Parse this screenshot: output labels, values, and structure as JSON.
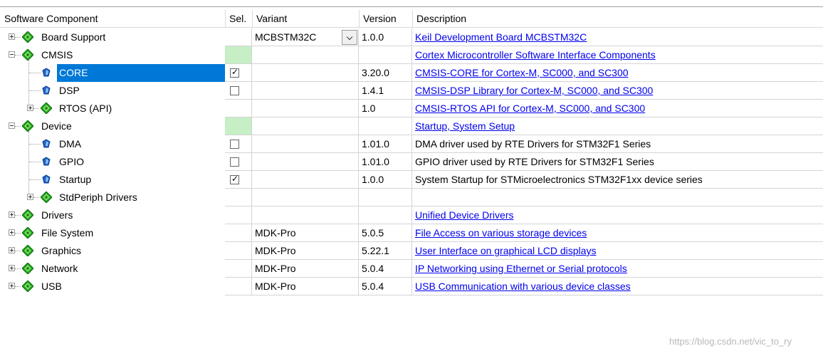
{
  "header": {
    "component": "Software Component",
    "sel": "Sel.",
    "variant": "Variant",
    "version": "Version",
    "description": "Description"
  },
  "rows": [
    {
      "label": "Board Support",
      "level": 0,
      "icon": "green-diamond-icon",
      "expander": "plus",
      "variant": "MCBSTM32C",
      "has_dropdown": true,
      "version": "1.0.0",
      "description": "Keil Development Board MCBSTM32C",
      "link": true,
      "checkbox": null,
      "green_sel": false
    },
    {
      "label": "CMSIS",
      "level": 0,
      "icon": "green-diamond-icon",
      "expander": "minus",
      "variant": "",
      "version": "",
      "description": "Cortex Microcontroller Software Interface Components",
      "link": true,
      "checkbox": null,
      "green_sel": true
    },
    {
      "label": "CORE",
      "level": 1,
      "icon": "blue-component-icon",
      "expander": "",
      "variant": "",
      "version": "3.20.0",
      "description": "CMSIS-CORE for Cortex-M, SC000, and SC300",
      "link": true,
      "checkbox": true,
      "green_sel": false,
      "selected": true
    },
    {
      "label": "DSP",
      "level": 1,
      "icon": "blue-component-icon",
      "expander": "",
      "variant": "",
      "version": "1.4.1",
      "description": "CMSIS-DSP Library for Cortex-M, SC000, and SC300",
      "link": true,
      "checkbox": false,
      "green_sel": false
    },
    {
      "label": "RTOS (API)",
      "level": 1,
      "icon": "green-diamond-icon",
      "expander": "plus",
      "variant": "",
      "version": "1.0",
      "description": "CMSIS-RTOS API for Cortex-M, SC000, and SC300",
      "link": true,
      "checkbox": null,
      "green_sel": false
    },
    {
      "label": "Device",
      "level": 0,
      "icon": "green-diamond-icon",
      "expander": "minus",
      "variant": "",
      "version": "",
      "description": "Startup, System Setup",
      "link": true,
      "checkbox": null,
      "green_sel": true
    },
    {
      "label": "DMA",
      "level": 1,
      "icon": "blue-component-icon",
      "expander": "",
      "variant": "",
      "version": "1.01.0",
      "description": "DMA driver used by RTE Drivers for STM32F1 Series",
      "link": false,
      "checkbox": false,
      "green_sel": false
    },
    {
      "label": "GPIO",
      "level": 1,
      "icon": "blue-component-icon",
      "expander": "",
      "variant": "",
      "version": "1.01.0",
      "description": "GPIO driver used by RTE Drivers for STM32F1 Series",
      "link": false,
      "checkbox": false,
      "green_sel": false
    },
    {
      "label": "Startup",
      "level": 1,
      "icon": "blue-component-icon",
      "expander": "",
      "variant": "",
      "version": "1.0.0",
      "description": "System Startup for STMicroelectronics STM32F1xx device series",
      "link": false,
      "checkbox": true,
      "green_sel": false
    },
    {
      "label": "StdPeriph Drivers",
      "level": 1,
      "icon": "green-diamond-icon",
      "expander": "plus",
      "variant": "",
      "version": "",
      "description": "",
      "link": false,
      "checkbox": null,
      "green_sel": false
    },
    {
      "label": "Drivers",
      "level": 0,
      "icon": "green-diamond-icon",
      "expander": "plus",
      "variant": "",
      "version": "",
      "description": "Unified Device Drivers",
      "link": true,
      "checkbox": null,
      "green_sel": false
    },
    {
      "label": "File System",
      "level": 0,
      "icon": "green-diamond-icon",
      "expander": "plus",
      "variant": "MDK-Pro",
      "version": "5.0.5",
      "description": "File Access on various storage devices",
      "link": true,
      "checkbox": null,
      "green_sel": false
    },
    {
      "label": "Graphics",
      "level": 0,
      "icon": "green-diamond-icon",
      "expander": "plus",
      "variant": "MDK-Pro",
      "version": "5.22.1",
      "description": "User Interface on graphical LCD displays",
      "link": true,
      "checkbox": null,
      "green_sel": false
    },
    {
      "label": "Network",
      "level": 0,
      "icon": "green-diamond-icon",
      "expander": "plus",
      "variant": "MDK-Pro",
      "version": "5.0.4",
      "description": "IP Networking using Ethernet or Serial protocols",
      "link": true,
      "checkbox": null,
      "green_sel": false
    },
    {
      "label": "USB",
      "level": 0,
      "icon": "green-diamond-icon",
      "expander": "plus",
      "variant": "MDK-Pro",
      "version": "5.0.4",
      "description": "USB Communication with various device classes",
      "link": true,
      "checkbox": null,
      "green_sel": false
    }
  ],
  "watermark": "https://blog.csdn.net/vic_to_ry",
  "colors": {
    "selection": "#0078d7",
    "green_cell": "#c6efc6",
    "link": "#0000ee",
    "diamond": "#1fa31f"
  }
}
